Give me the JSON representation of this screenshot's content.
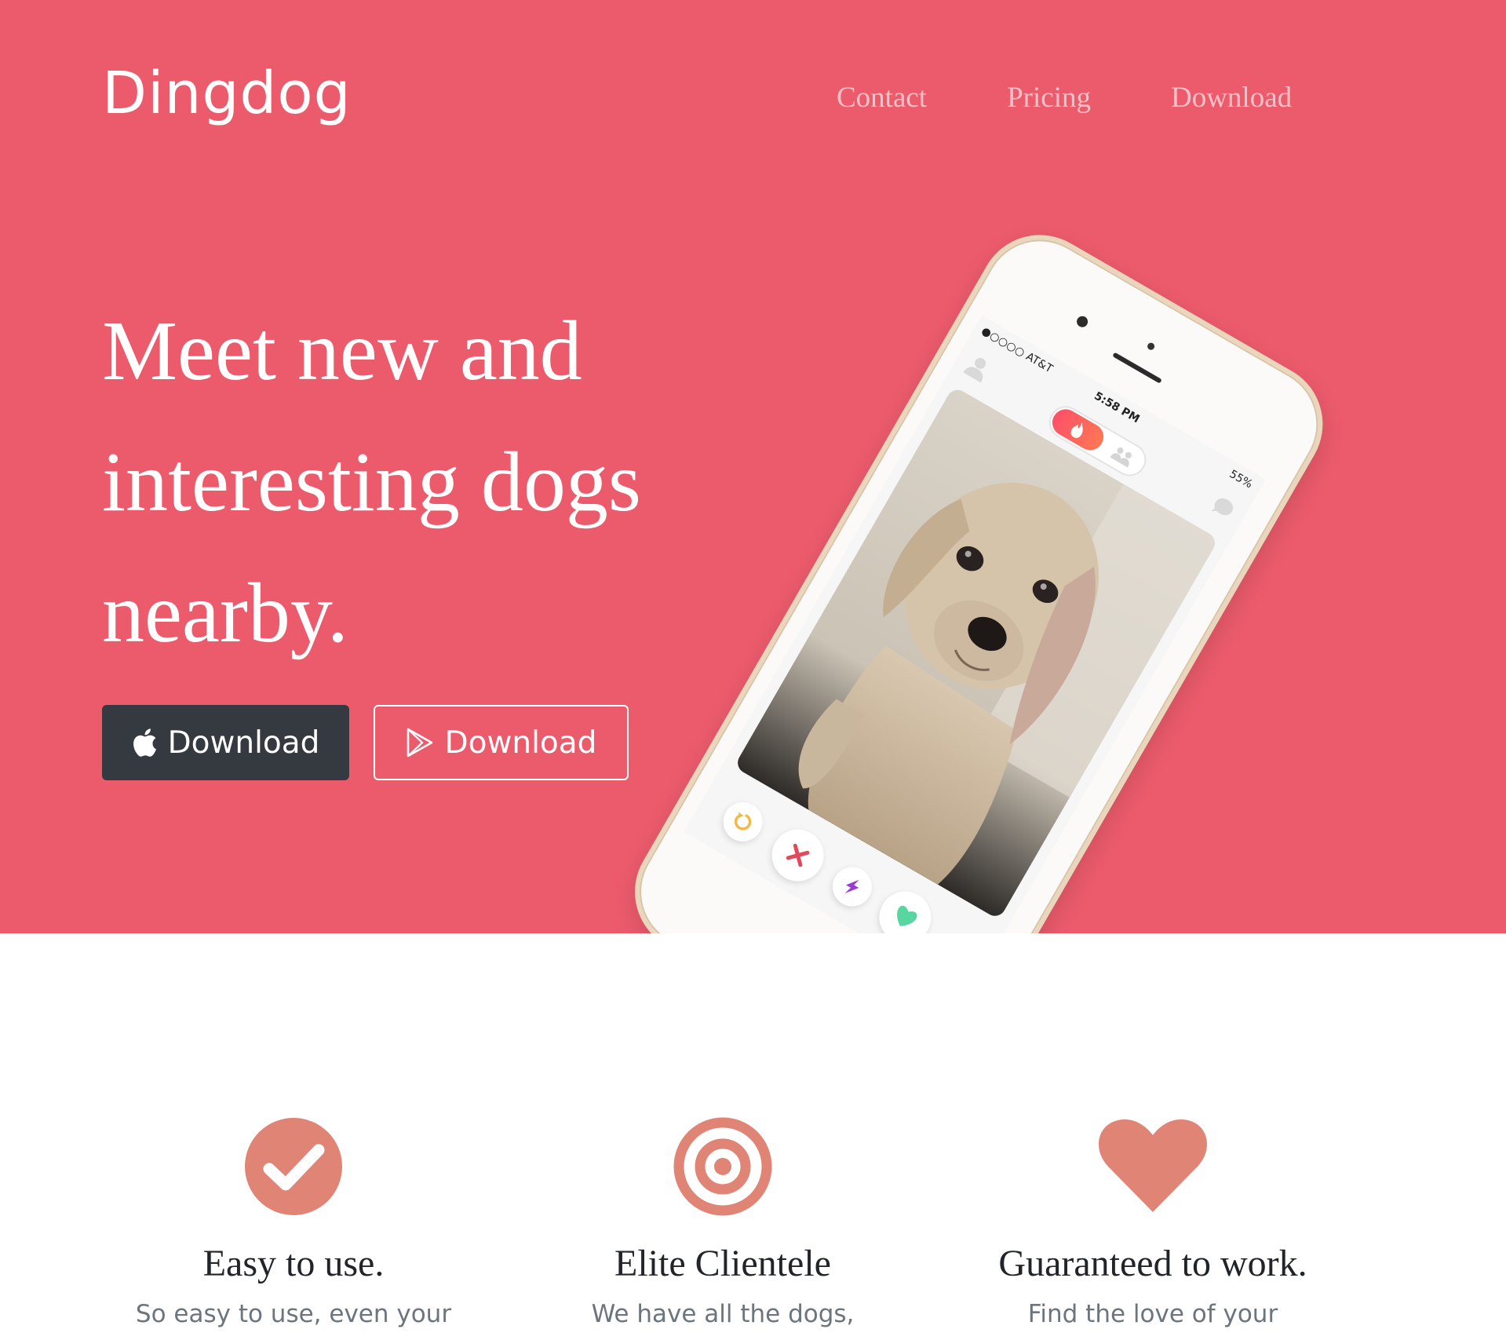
{
  "brand": {
    "name": "Dingdog"
  },
  "nav": {
    "items": [
      {
        "label": "Contact"
      },
      {
        "label": "Pricing"
      },
      {
        "label": "Download"
      }
    ]
  },
  "hero": {
    "headline": "Meet new and interesting dogs nearby.",
    "buttons": {
      "apple": {
        "label": "Download",
        "icon": "apple-icon"
      },
      "google_play": {
        "label": "Download",
        "icon": "play-store-icon"
      }
    }
  },
  "phone": {
    "status": {
      "carrier": "●○○○○ AT&T",
      "time": "5:58 PM",
      "battery": "55%"
    }
  },
  "features": [
    {
      "icon": "check-circle-icon",
      "title": "Easy to use.",
      "text": "So easy to use, even your"
    },
    {
      "icon": "target-icon",
      "title": "Elite Clientele",
      "text": "We have all the dogs,"
    },
    {
      "icon": "heart-icon",
      "title": "Guaranteed to work.",
      "text": "Find the love of your"
    }
  ],
  "colors": {
    "hero_background": "#eb5b6c",
    "nav_link": "#f7c0c6",
    "apple_button": "#343a40",
    "feature_icon": "#e08476",
    "feature_title": "#212529",
    "feature_text": "#6c757d"
  }
}
